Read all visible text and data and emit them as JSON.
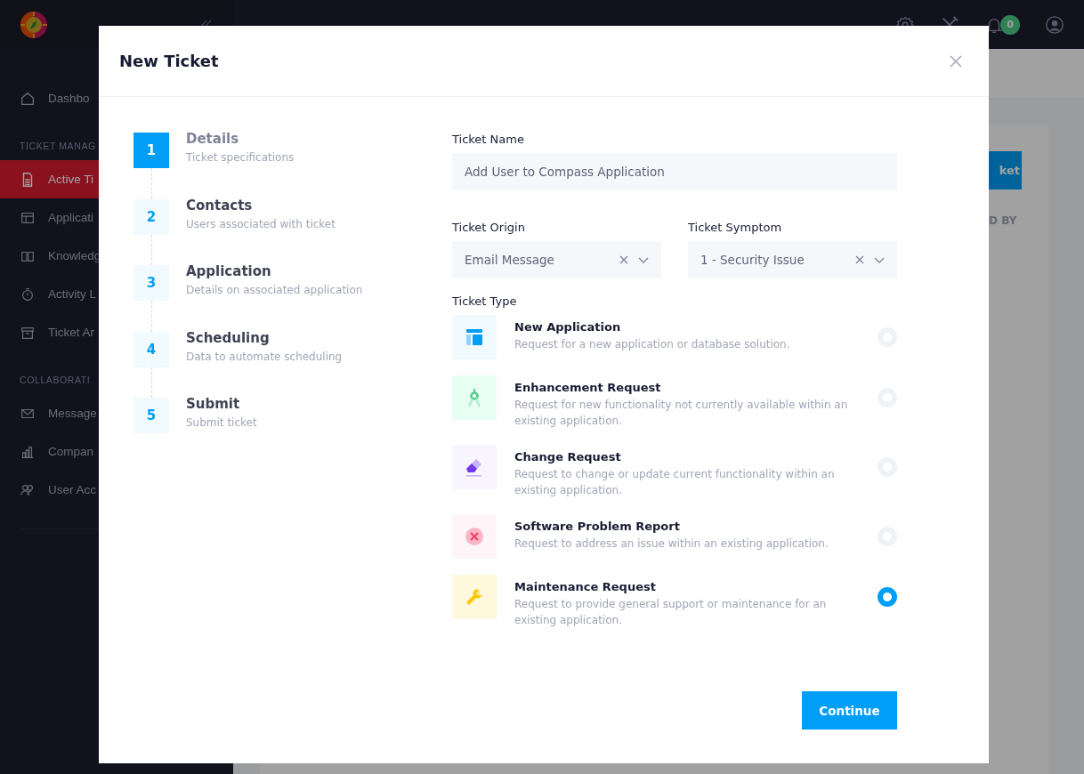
{
  "sidebar": {
    "sections": [
      {
        "items": [
          {
            "label": "Dashbo",
            "selected": false
          }
        ]
      },
      {
        "title": "TICKET MANAG",
        "items": [
          {
            "label": "Active Ti",
            "selected": true
          },
          {
            "label": "Applicati",
            "selected": false
          },
          {
            "label": "Knowledg",
            "selected": false
          },
          {
            "label": "Activity L",
            "selected": false
          },
          {
            "label": "Ticket Ar",
            "selected": false
          }
        ]
      },
      {
        "title": "COLLABORATI",
        "items": [
          {
            "label": "Message",
            "selected": false
          },
          {
            "label": "Compan",
            "selected": false
          },
          {
            "label": "User Acc",
            "selected": false
          }
        ]
      }
    ]
  },
  "topbar": {
    "notification_count": "0"
  },
  "background": {
    "button": "ket",
    "column_header": "D BY"
  },
  "modal": {
    "title": "New Ticket",
    "steps": [
      {
        "number": "1",
        "title": "Details",
        "subtitle": "Ticket specifications",
        "selected": true
      },
      {
        "number": "2",
        "title": "Contacts",
        "subtitle": "Users associated with ticket",
        "selected": false
      },
      {
        "number": "3",
        "title": "Application",
        "subtitle": "Details on associated application",
        "selected": false
      },
      {
        "number": "4",
        "title": "Scheduling",
        "subtitle": "Data to automate scheduling",
        "selected": false
      },
      {
        "number": "5",
        "title": "Submit",
        "subtitle": "Submit ticket",
        "selected": false
      }
    ],
    "ticket_name": {
      "label": "Ticket Name",
      "value": "Add User to Compass Application"
    },
    "selects": [
      {
        "label": "Ticket Origin",
        "value": "Email Message"
      },
      {
        "label": "Ticket Symptom",
        "value": "1 - Security Issue"
      }
    ],
    "ticket_type": {
      "label": "Ticket Type",
      "options": [
        {
          "title": "New Application",
          "description": "Request for a new application or database solution.",
          "selected": false
        },
        {
          "title": "Enhancement Request",
          "description": "Request for new functionality not currently available within an existing application.",
          "selected": false
        },
        {
          "title": "Change Request",
          "description": "Request to change or update current functionality within an existing application.",
          "selected": false
        },
        {
          "title": "Software Problem Report",
          "description": "Request to address an issue within an existing application.",
          "selected": false
        },
        {
          "title": "Maintenance Request",
          "description": "Request to provide general support or maintenance for an existing application.",
          "selected": true
        }
      ]
    },
    "continue_button": "Continue"
  }
}
